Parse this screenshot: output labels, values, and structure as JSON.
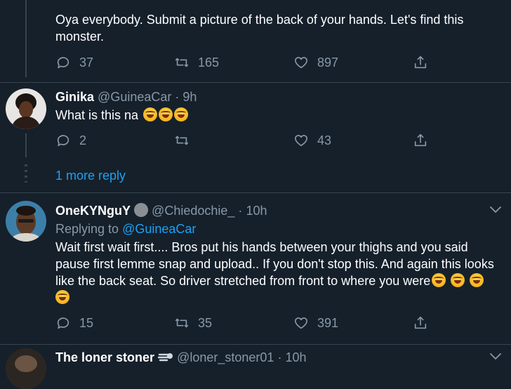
{
  "top_tweet": {
    "text": "Oya everybody. Submit a picture of the back of your hands. Let's find this monster.",
    "replies": "37",
    "retweets": "165",
    "likes": "897"
  },
  "reply1": {
    "name": "Ginika",
    "handle": "@GuineaCar",
    "sep": "·",
    "time": "9h",
    "text": "What is this na",
    "emoji_count": 3,
    "replies": "2",
    "retweets": "",
    "likes": "43"
  },
  "more_replies": "1 more reply",
  "reply2": {
    "name": "OneKYNguY",
    "handle": "@Chiedochie_",
    "sep": "·",
    "time": "10h",
    "replying_prefix": "Replying to",
    "replying_to": "@GuineaCar",
    "text_line1": "Wait first wait first.... Bros put his hands between your thighs and you said",
    "text_line2": "pause first lemme snap and upload.. If you don't stop this. And again this looks",
    "text_line3": "like the back seat. So driver stretched from front to where you were",
    "replies": "15",
    "retweets": "35",
    "likes": "391"
  },
  "reply3": {
    "name": "The loner stoner",
    "handle": "@loner_stoner01",
    "sep": "·",
    "time": "10h"
  },
  "icons": {
    "reply": "speech-bubble-icon",
    "retweet": "retweet-icon",
    "like": "heart-icon",
    "share": "share-icon"
  },
  "colors": {
    "background": "#15202b",
    "muted": "#8899a6",
    "accent": "#1da1f2",
    "divider": "#38444d"
  }
}
